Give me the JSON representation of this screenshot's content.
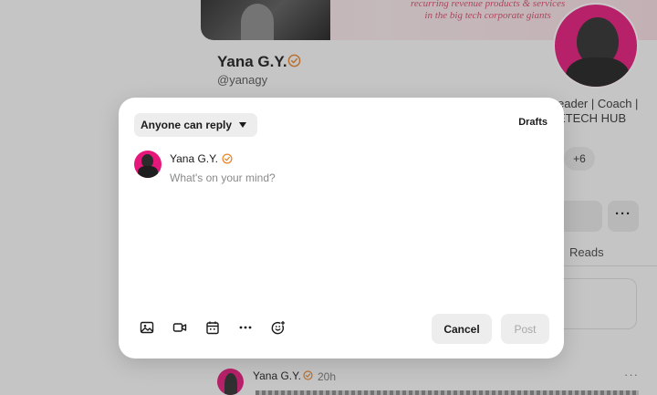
{
  "background": {
    "banner_text": [
      "recurring revenue products & services",
      "in the big tech corporate giants"
    ],
    "profile_name": "Yana G.Y.",
    "profile_handle": "@yanagy",
    "bio_line1": "eader | Coach |",
    "bio_line2": "ETECH HUB",
    "extra_count": "+6",
    "more_label": "···",
    "tab_reads": "Reads",
    "post": {
      "author": "Yana G.Y.",
      "time": "20h",
      "menu": "···"
    }
  },
  "composer": {
    "reply_setting": "Anyone can reply",
    "drafts_label": "Drafts",
    "author_name": "Yana G.Y.",
    "placeholder": "What's on your mind?",
    "cancel_label": "Cancel",
    "post_label": "Post",
    "tools": [
      "image-icon",
      "video-icon",
      "calendar-icon",
      "more-icon",
      "emoji-add-icon"
    ]
  },
  "colors": {
    "accent_check": "#e8852c",
    "avatar_bg": "#e6177a",
    "button_bg": "#ededed"
  }
}
